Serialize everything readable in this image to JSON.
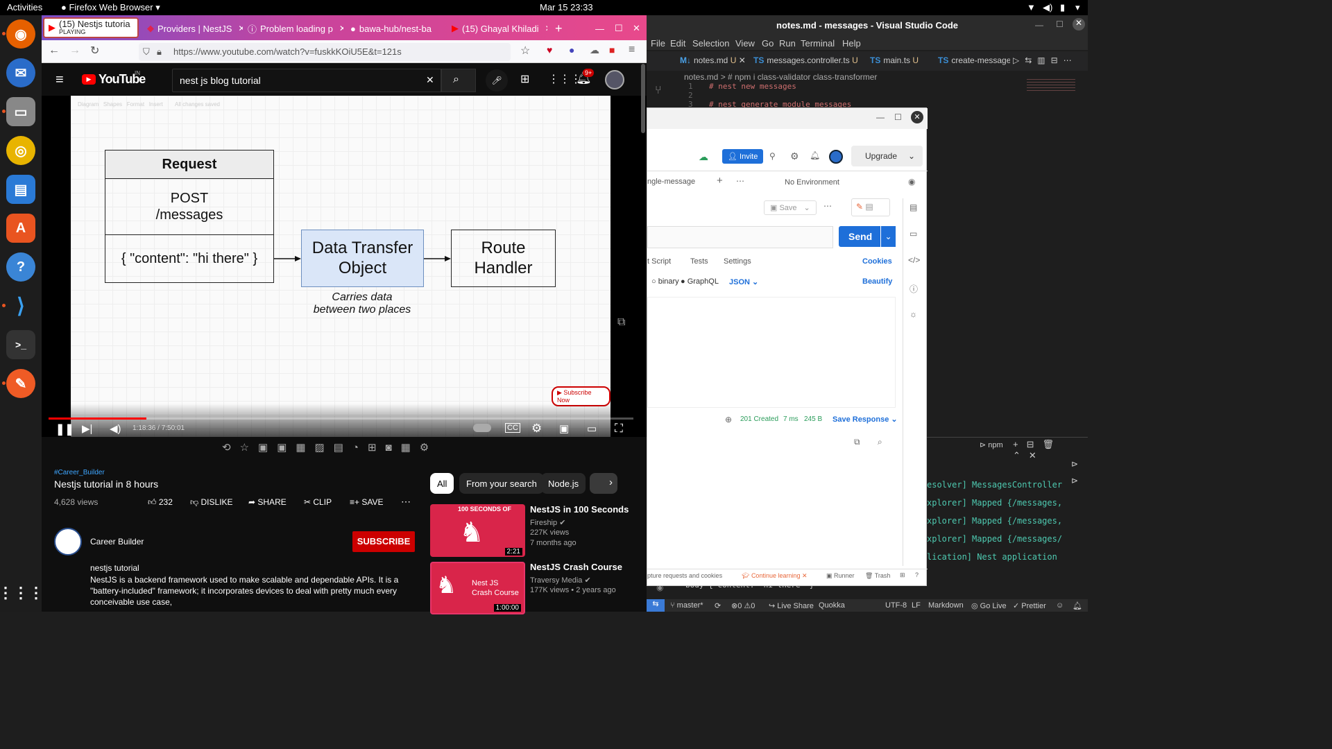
{
  "topbar": {
    "activities": "Activities",
    "app": "Firefox Web Browser ▾",
    "datetime": "Mar 15  23:33"
  },
  "firefox": {
    "tabs": [
      {
        "label": "(15) Nestjs tutoria",
        "sub": "PLAYING"
      },
      {
        "label": "Providers | NestJS"
      },
      {
        "label": "Problem loading p"
      },
      {
        "label": "bawa-hub/nest-ba"
      },
      {
        "label": "(15) Ghayal Khiladi"
      }
    ],
    "url": "https://www.youtube.com/watch?v=fuskkKOiU5E&t=121s"
  },
  "youtube": {
    "logo": "YouTube",
    "region": "IN",
    "search_value": "nest js blog tutorial",
    "notif_badge": "9+",
    "slide": {
      "toolbar": "Diagram   Shapes   Format   Insert        All changes saved",
      "request_header": "Request",
      "request_method": "POST\n/messages",
      "request_body": "{ \"content\": \"hi there\" }",
      "dto_label": "Data Transfer\nObject",
      "handler_label": "Route\nHandler",
      "dto_caption": "Carries data\nbetween two places",
      "subscribe_now": "Subscribe Now"
    },
    "player": {
      "time": "1:18:36 / 7:50:01",
      "progress": 0.167
    },
    "hashtag": "#Career_Builder",
    "title": "Nestjs tutorial in 8 hours",
    "views": "4,628 views",
    "actions": {
      "likes": "232",
      "dislike": "DISLIKE",
      "share": "SHARE",
      "clip": "CLIP",
      "save": "SAVE"
    },
    "channel": {
      "name": "Career Builder",
      "subscribe": "SUBSCRIBE"
    },
    "description": {
      "line1": "nestjs tutorial",
      "line2": "NestJS is a backend framework used to make scalable and dependable APIs. It is a \"battery-included\" framework; it incorporates devices to deal with pretty much every conceivable use case,"
    },
    "chips": [
      "All",
      "From your search",
      "Node.js"
    ],
    "recommended": [
      {
        "title": "NestJS in 100 Seconds",
        "channel": "Fireship",
        "views": "227K views",
        "age": "7 months ago",
        "duration": "2:21",
        "thumb_text": "100 SECONDS OF"
      },
      {
        "title": "NestJS Crash Course",
        "channel": "Traversy Media",
        "views": "177K views • 2 years ago",
        "duration": "1:00:00",
        "thumb_text": "Nest JS\nCrash Course"
      }
    ]
  },
  "vscode": {
    "title": "notes.md - messages - Visual Studio Code",
    "menu": [
      "File",
      "Edit",
      "Selection",
      "View",
      "Go",
      "Run",
      "Terminal",
      "Help"
    ],
    "tabs": [
      {
        "label": "notes.md",
        "mark": "U"
      },
      {
        "label": "messages.controller.ts",
        "mark": "U"
      },
      {
        "label": "main.ts",
        "mark": "U"
      },
      {
        "label": "create-message.c"
      }
    ],
    "breadcrumb": "notes.md > # npm i class-validator class-transformer",
    "lines": [
      {
        "n": "1",
        "text": "# nest new messages"
      },
      {
        "n": "2",
        "text": ""
      },
      {
        "n": "3",
        "text": "# nest generate module messages"
      }
    ],
    "terminal_label": "npm",
    "terminal": [
      "esolver] MessagesController",
      "xplorer] Mapped {/messages,",
      "xplorer] Mapped {/messages,",
      "xplorer] Mapped {/messages/",
      "lication] Nest application"
    ],
    "bottom_code": "body { content: 'hi there' }",
    "status": {
      "branch": "master*",
      "errors": "0",
      "warnings": "0",
      "liveshare": "Live Share",
      "quokka": "Quokka",
      "encoding": "UTF-8",
      "eol": "LF",
      "lang": "Markdown",
      "golive": "Go Live",
      "prettier": "Prettier"
    }
  },
  "postman": {
    "invite": "Invite",
    "upgrade": "Upgrade",
    "request_tab": "ngle-message",
    "environment": "No Environment",
    "save": "Save",
    "send": "Send",
    "subtabs": [
      "t Script",
      "Tests",
      "Settings"
    ],
    "cookies": "Cookies",
    "body_types": [
      "binary",
      "GraphQL",
      "JSON"
    ],
    "beautify": "Beautify",
    "status": "201 Created",
    "time": "7 ms",
    "size": "245 B",
    "save_response": "Save Response",
    "footer": {
      "capture": "pture requests and cookies",
      "continue": "Continue learning",
      "runner": "Runner",
      "trash": "Trash"
    }
  }
}
